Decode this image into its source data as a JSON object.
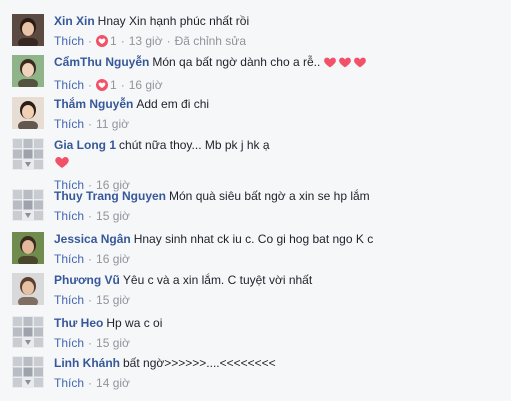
{
  "comments": [
    {
      "author": "Xin Xin",
      "text": "Hnay Xin hạnh phúc nhất rồi",
      "like_label": "Thích",
      "reaction_icon": "heart-reaction-icon",
      "reaction_count": "1",
      "time": "13 giờ",
      "edited": "Đã chỉnh sửa",
      "avatar": "photo"
    },
    {
      "author": "CẩmThu Nguyễn",
      "text": "Món qa bất ngờ dành cho a rễ..",
      "inline_hearts": 3,
      "like_label": "Thích",
      "reaction_icon": "heart-reaction-icon",
      "reaction_count": "1",
      "time": "16 giờ",
      "avatar": "photo"
    },
    {
      "author": "Thắm Nguyễn",
      "text": "Add em đi chi",
      "like_label": "Thích",
      "time": "11 giờ",
      "avatar": "photo"
    },
    {
      "author": "Gia Long 1",
      "text": "chút nữa thoy... Mb pk j hk ạ",
      "big_heart": true,
      "like_label": "Thích",
      "time": "16 giờ",
      "avatar": "default"
    },
    {
      "author": "Thuy Trang Nguyen",
      "text": "Món quà siêu bất ngờ a xin se hp lắm",
      "like_label": "Thích",
      "time": "15 giờ",
      "avatar": "default"
    },
    {
      "author": "Jessica Ngân",
      "text": "Hnay sinh nhat ck iu c. Co gi hog bat ngo K c",
      "like_label": "Thích",
      "time": "16 giờ",
      "avatar": "photo"
    },
    {
      "author": "Phương Vũ",
      "text": "Yêu c và a xin lắm. C tuyệt vời nhất",
      "like_label": "Thích",
      "time": "15 giờ",
      "avatar": "photo"
    },
    {
      "author": "Thư Heo",
      "text": "Hp wa c oi",
      "like_label": "Thích",
      "time": "15 giờ",
      "avatar": "default"
    },
    {
      "author": "Linh Khánh",
      "text": "bất ngờ>>>>>>....<<<<<<<<",
      "like_label": "Thích",
      "time": "14 giờ",
      "avatar": "default"
    }
  ],
  "colors": {
    "author": "#365899",
    "like": "#4267b2",
    "meta": "#90949c",
    "heart": "#f25268",
    "background": "#f6f7f9"
  }
}
